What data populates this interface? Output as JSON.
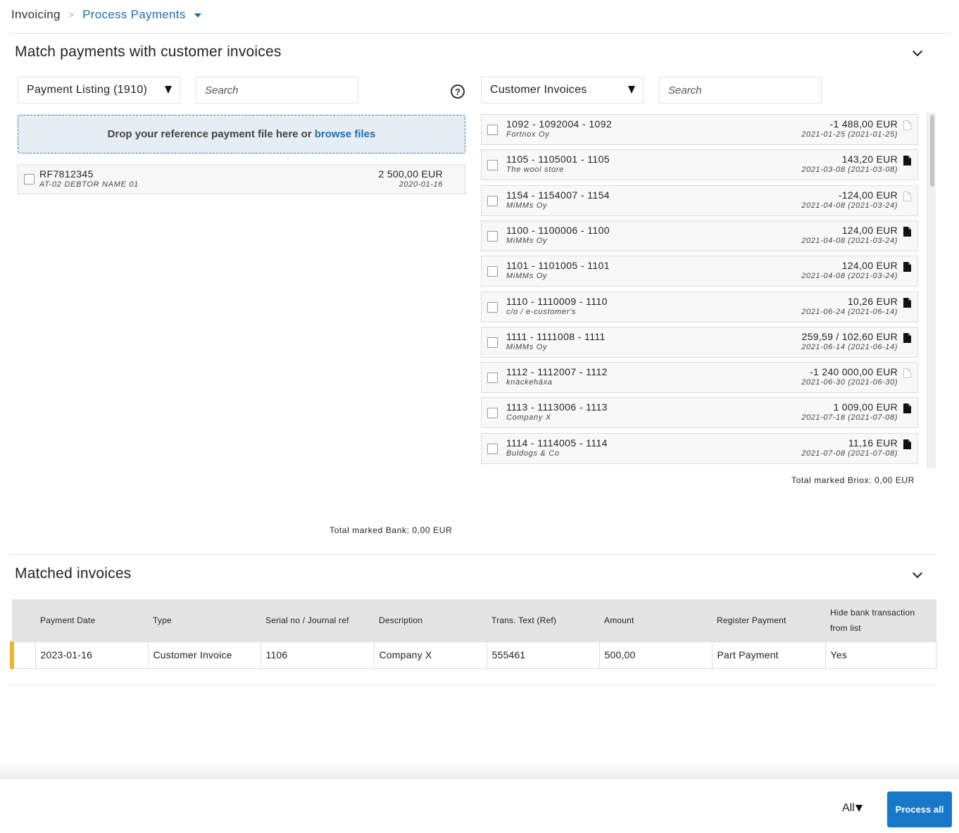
{
  "breadcrumb": {
    "root": "Invoicing",
    "separator": ">",
    "current": "Process Payments"
  },
  "match_section": {
    "title": "Match payments with customer invoices"
  },
  "payment_listing": {
    "select_value": "Payment Listing (1910)",
    "search_placeholder": "Search",
    "dropzone_text": "Drop your reference payment file here or",
    "dropzone_link": "browse files",
    "payments": [
      {
        "ref": "RF7812345",
        "debtor": "AT-02 DEBTOR NAME 01",
        "amount": "2 500,00 EUR",
        "date": "2020-01-16"
      }
    ],
    "total_label": "Total marked Bank: 0,00 EUR"
  },
  "customer_invoices": {
    "select_value": "Customer Invoices",
    "search_placeholder": "Search",
    "invoices": [
      {
        "title": "1092 - 1092004 - 1092",
        "customer": "Fortnox Oy",
        "amount": "-1 488,00 EUR",
        "dates": "2021-01-25 (2021-01-25)",
        "icon": "document-outline-icon"
      },
      {
        "title": "1105 - 1105001 - 1105",
        "customer": "The wool store",
        "amount": "143,20 EUR",
        "dates": "2021-03-08 (2021-03-08)",
        "icon": "document-filled-icon"
      },
      {
        "title": "1154 - 1154007 - 1154",
        "customer": "MiMMs Oy",
        "amount": "-124,00 EUR",
        "dates": "2021-04-08 (2021-03-24)",
        "icon": "document-outline-icon"
      },
      {
        "title": "1100 - 1100006 - 1100",
        "customer": "MiMMs Oy",
        "amount": "124,00 EUR",
        "dates": "2021-04-08 (2021-03-24)",
        "icon": "document-filled-icon"
      },
      {
        "title": "1101 - 1101005 - 1101",
        "customer": "MiMMs Oy",
        "amount": "124,00 EUR",
        "dates": "2021-04-08 (2021-03-24)",
        "icon": "document-filled-icon"
      },
      {
        "title": "1110 - 1110009 - 1110",
        "customer": "c/o / e-customer's",
        "amount": "10,26 EUR",
        "dates": "2021-06-24 (2021-06-14)",
        "icon": "document-filled-icon"
      },
      {
        "title": "1111 - 1111008 - 1111",
        "customer": "MiMMs Oy",
        "amount": "259,59 / 102,60 EUR",
        "dates": "2021-06-14 (2021-06-14)",
        "icon": "document-filled-icon"
      },
      {
        "title": "1112 - 1112007 - 1112",
        "customer": "knäckehäxa",
        "amount": "-1 240 000,00 EUR",
        "dates": "2021-06-30 (2021-06-30)",
        "icon": "document-outline-icon"
      },
      {
        "title": "1113 - 1113006 - 1113",
        "customer": "Company X",
        "amount": "1 009,00 EUR",
        "dates": "2021-07-18 (2021-07-08)",
        "icon": "document-filled-icon"
      },
      {
        "title": "1114 - 1114005 - 1114",
        "customer": "Buldogs & Co",
        "amount": "11,16 EUR",
        "dates": "2021-07-08 (2021-07-08)",
        "icon": "document-filled-icon"
      }
    ],
    "total_label": "Total marked Briox: 0,00 EUR"
  },
  "matched_section": {
    "title": "Matched invoices",
    "columns": [
      "Payment Date",
      "Type",
      "Serial no / Journal ref",
      "Description",
      "Trans. Text (Ref)",
      "Amount",
      "Register Payment",
      "Hide bank transaction from list"
    ],
    "rows": [
      {
        "status_color": "#f0b429",
        "cells": [
          "2023-01-16",
          "Customer Invoice",
          "1106",
          "Company X",
          "555461",
          "500,00",
          "Part Payment",
          "Yes"
        ]
      }
    ]
  },
  "footer": {
    "filter_value": "All",
    "process_label": "Process all"
  },
  "colors": {
    "link": "#1b6fb5",
    "primary_button": "#1878c8",
    "status_marker": "#f0b429"
  }
}
